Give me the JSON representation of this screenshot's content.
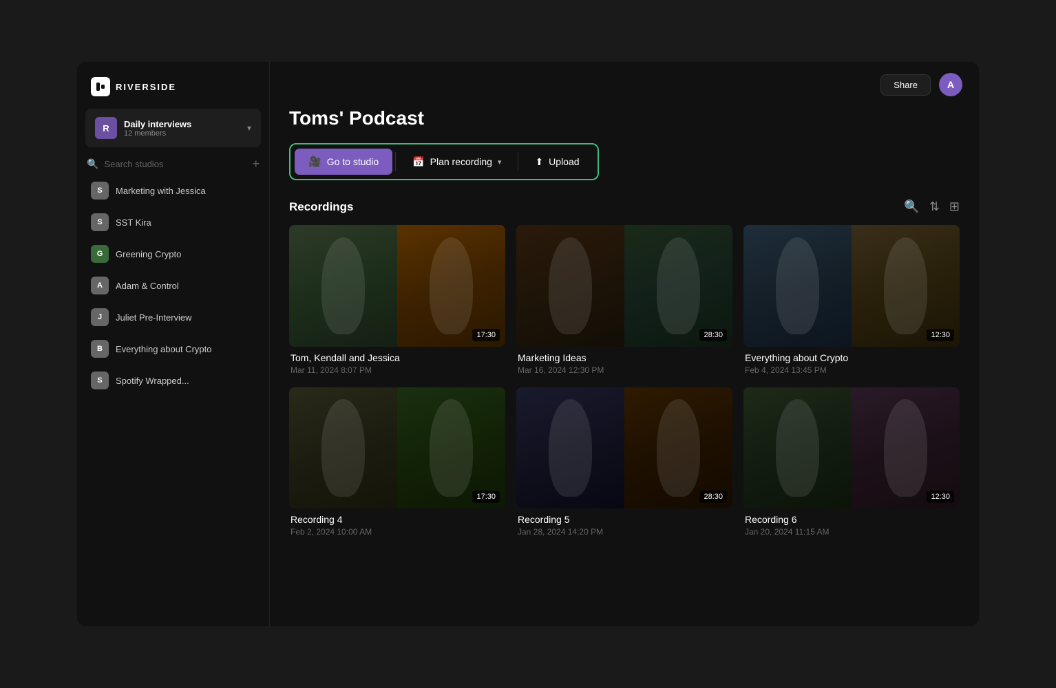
{
  "app": {
    "logo_text": "RIVERSIDE"
  },
  "workspace": {
    "avatar_letter": "R",
    "name": "Daily interviews",
    "members": "12 members",
    "chevron": "▾"
  },
  "sidebar": {
    "search_placeholder": "Search studios",
    "add_icon": "+",
    "studios": [
      {
        "letter": "S",
        "name": "Marketing with Jessica",
        "color": "#888"
      },
      {
        "letter": "S",
        "name": "SST Kira",
        "color": "#888"
      },
      {
        "letter": "G",
        "name": "Greening Crypto",
        "color": "#4a7a4a"
      },
      {
        "letter": "A",
        "name": "Adam & Control",
        "color": "#888"
      },
      {
        "letter": "J",
        "name": "Juliet Pre-Interview",
        "color": "#888"
      },
      {
        "letter": "B",
        "name": "Everything about Crypto",
        "color": "#888"
      },
      {
        "letter": "S",
        "name": "Spotify Wrapped...",
        "color": "#888"
      }
    ]
  },
  "topbar": {
    "share_label": "Share",
    "user_letter": "A"
  },
  "page": {
    "title": "Toms' Podcast"
  },
  "toolbar": {
    "goto_studio_label": "Go to studio",
    "plan_recording_label": "Plan recording",
    "upload_label": "Upload"
  },
  "recordings": {
    "section_title": "Recordings",
    "items": [
      {
        "name": "Tom, Kendall and Jessica",
        "date": "Mar 11, 2024 8:07 PM",
        "duration": "17:30"
      },
      {
        "name": "Marketing Ideas",
        "date": "Mar 16, 2024 12:30 PM",
        "duration": "28:30"
      },
      {
        "name": "Everything about Crypto",
        "date": "Feb 4, 2024 13:45 PM",
        "duration": "12:30"
      },
      {
        "name": "Recording 4",
        "date": "Feb 2, 2024 10:00 AM",
        "duration": "17:30"
      },
      {
        "name": "Recording 5",
        "date": "Jan 28, 2024 14:20 PM",
        "duration": "28:30"
      },
      {
        "name": "Recording 6",
        "date": "Jan 20, 2024 11:15 AM",
        "duration": "12:30"
      }
    ]
  }
}
